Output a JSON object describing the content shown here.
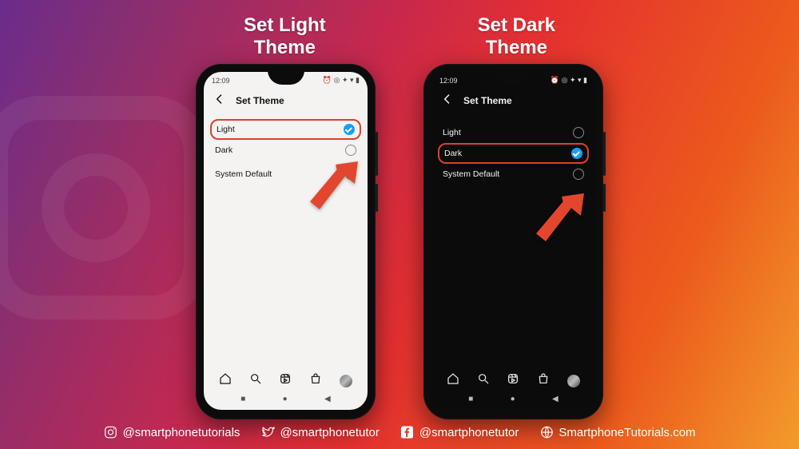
{
  "titles": {
    "light": "Set Light\nTheme",
    "dark": "Set Dark\nTheme"
  },
  "status": {
    "time": "12:09",
    "icons_right": "⏰ ◎ ✦ ▾ ▮"
  },
  "app": {
    "header_title": "Set Theme",
    "options": [
      {
        "label": "Light"
      },
      {
        "label": "Dark"
      },
      {
        "label": "System Default"
      }
    ]
  },
  "credits": {
    "instagram": "@smartphonetutorials",
    "twitter": "@smartphonetutor",
    "facebook": "@smartphonetutor",
    "web": "SmartphoneTutorials.com"
  }
}
